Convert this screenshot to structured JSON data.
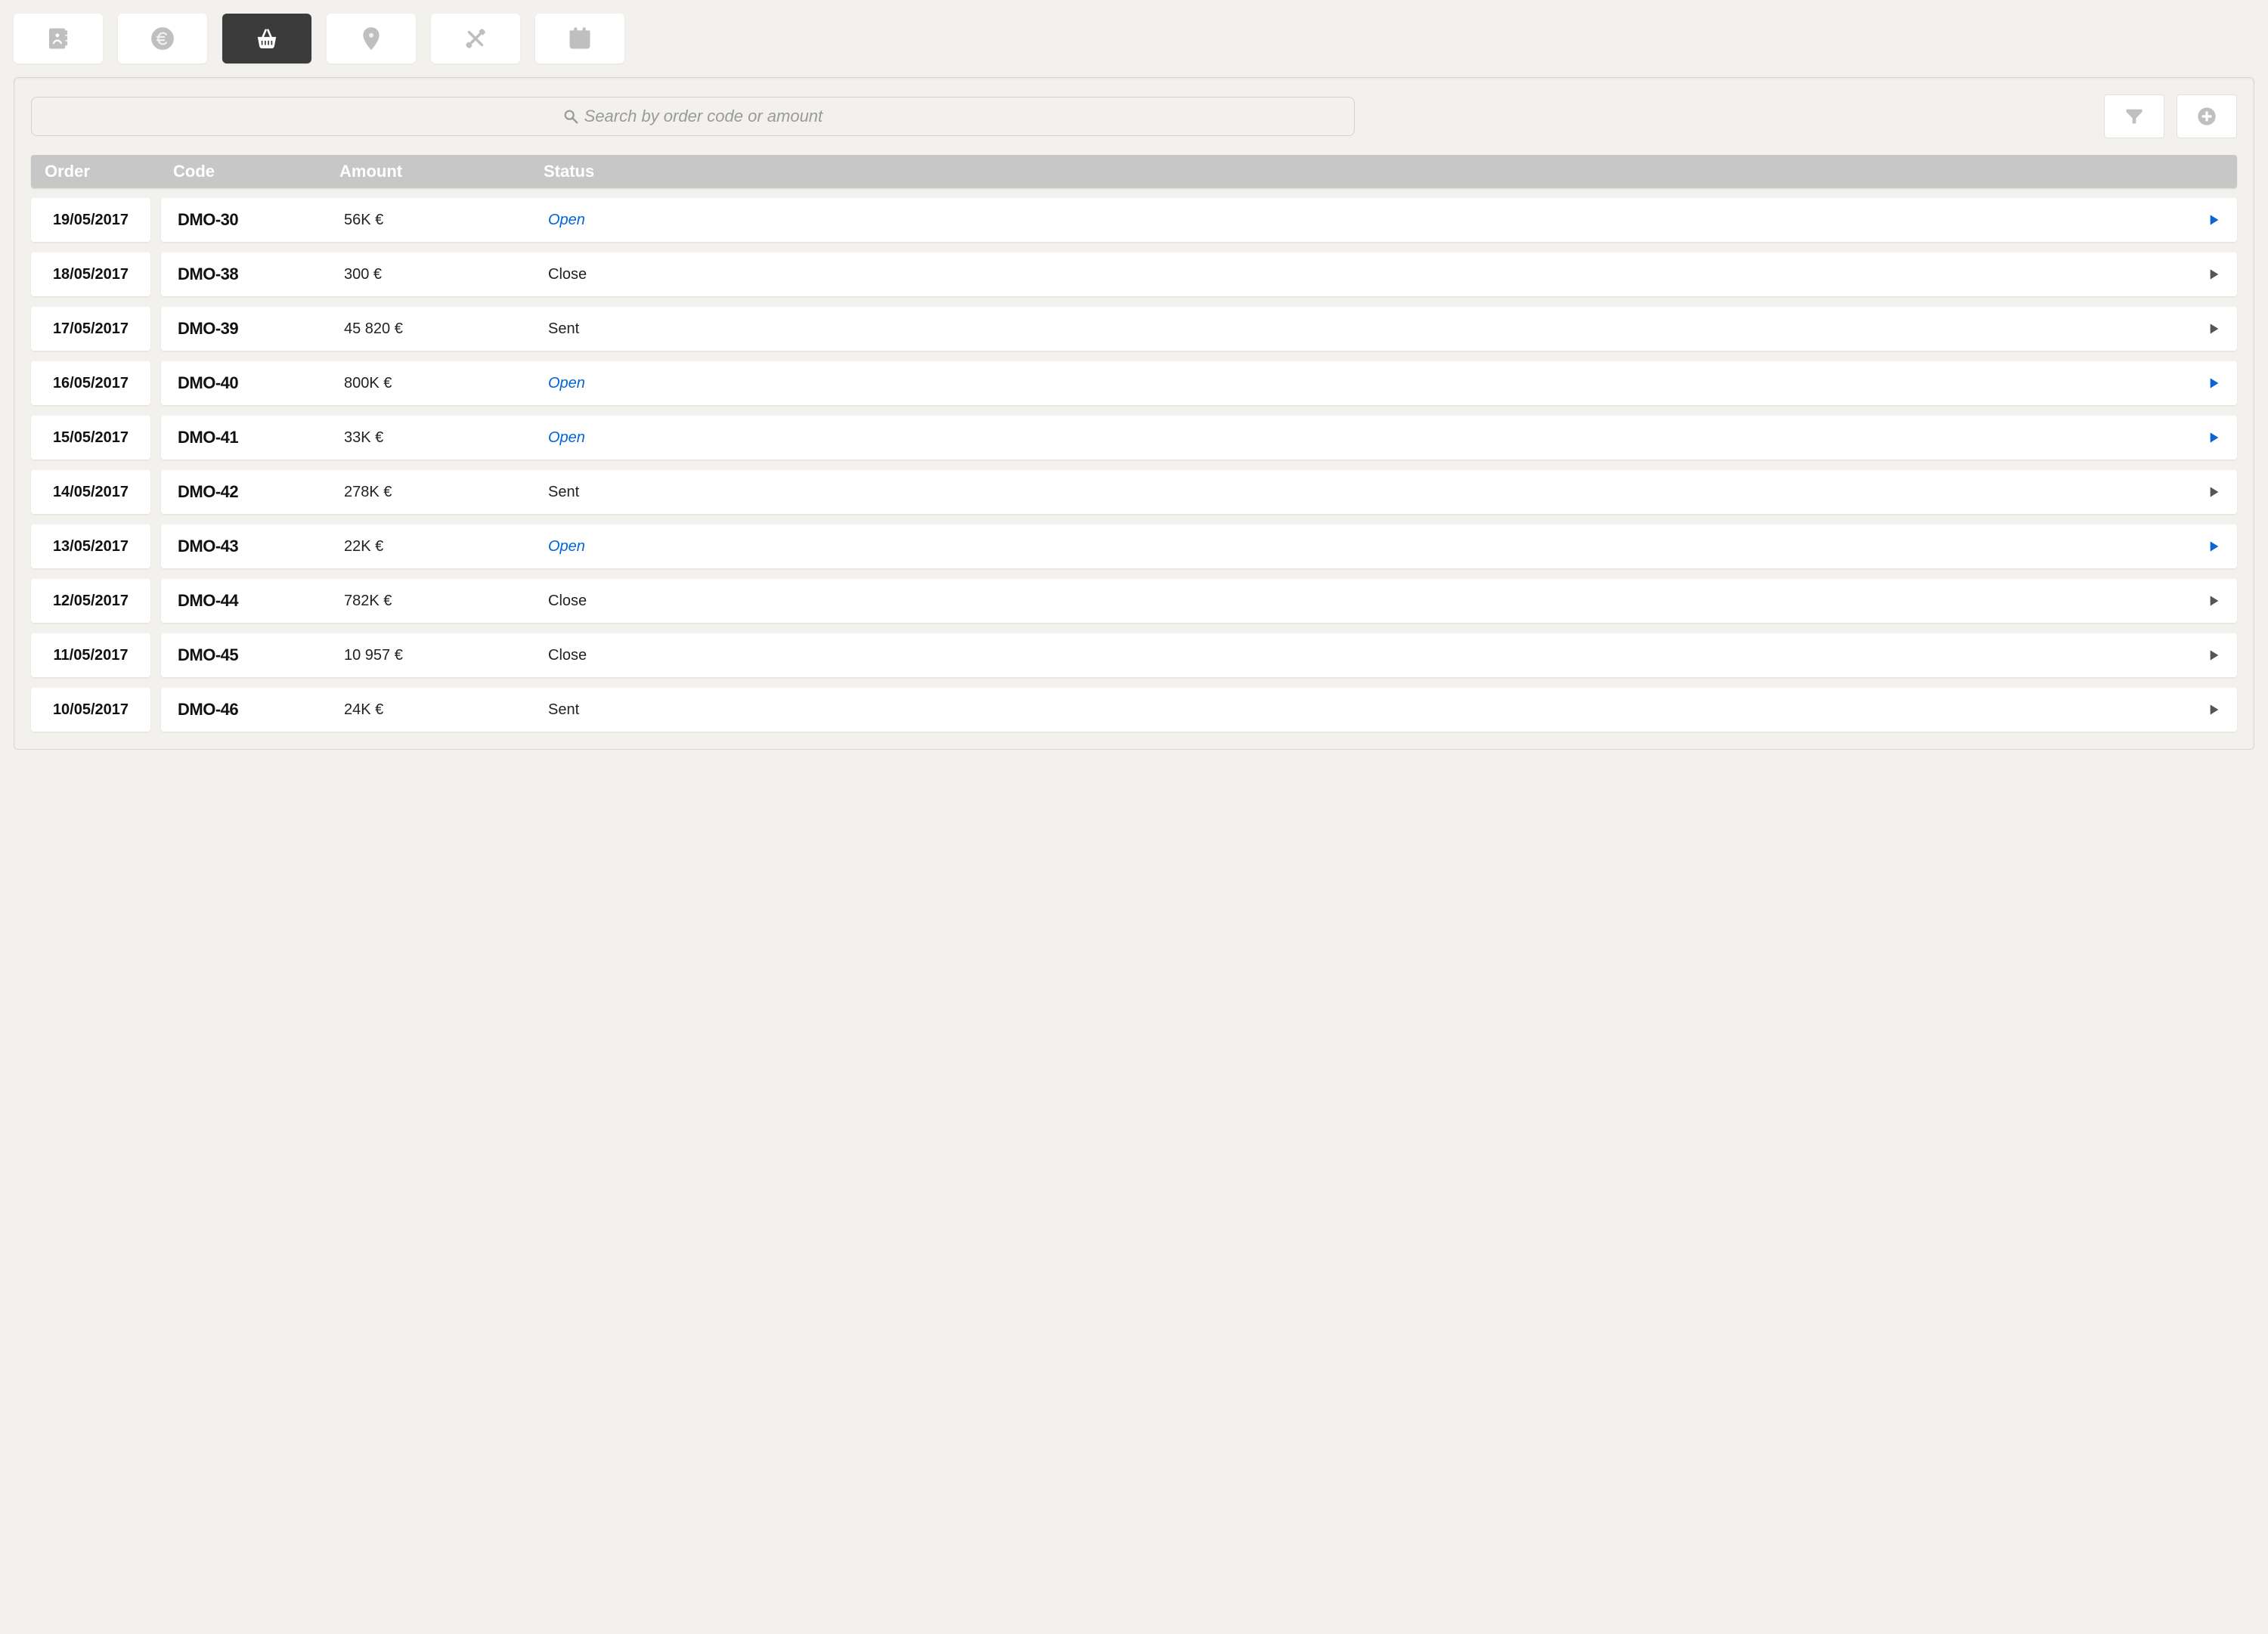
{
  "tabs": [
    {
      "icon": "contact-icon",
      "active": false
    },
    {
      "icon": "euro-icon",
      "active": false
    },
    {
      "icon": "basket-icon",
      "active": true
    },
    {
      "icon": "location-icon",
      "active": false
    },
    {
      "icon": "tools-icon",
      "active": false
    },
    {
      "icon": "calendar-icon",
      "active": false
    }
  ],
  "search": {
    "placeholder": "Search by order code or amount",
    "value": ""
  },
  "toolbar_icons": {
    "filter": "filter-icon",
    "add": "add-icon"
  },
  "columns": {
    "order": "Order",
    "code": "Code",
    "amount": "Amount",
    "status": "Status"
  },
  "status_open_value": "Open",
  "orders": [
    {
      "date": "19/05/2017",
      "code": "DMO-30",
      "amount": "56K €",
      "status": "Open"
    },
    {
      "date": "18/05/2017",
      "code": "DMO-38",
      "amount": "300 €",
      "status": "Close"
    },
    {
      "date": "17/05/2017",
      "code": "DMO-39",
      "amount": "45 820 €",
      "status": "Sent"
    },
    {
      "date": "16/05/2017",
      "code": "DMO-40",
      "amount": "800K €",
      "status": "Open"
    },
    {
      "date": "15/05/2017",
      "code": "DMO-41",
      "amount": "33K €",
      "status": "Open"
    },
    {
      "date": "14/05/2017",
      "code": "DMO-42",
      "amount": "278K €",
      "status": "Sent"
    },
    {
      "date": "13/05/2017",
      "code": "DMO-43",
      "amount": "22K €",
      "status": "Open"
    },
    {
      "date": "12/05/2017",
      "code": "DMO-44",
      "amount": "782K €",
      "status": "Close"
    },
    {
      "date": "11/05/2017",
      "code": "DMO-45",
      "amount": "10 957 €",
      "status": "Close"
    },
    {
      "date": "10/05/2017",
      "code": "DMO-46",
      "amount": "24K €",
      "status": "Sent"
    }
  ]
}
